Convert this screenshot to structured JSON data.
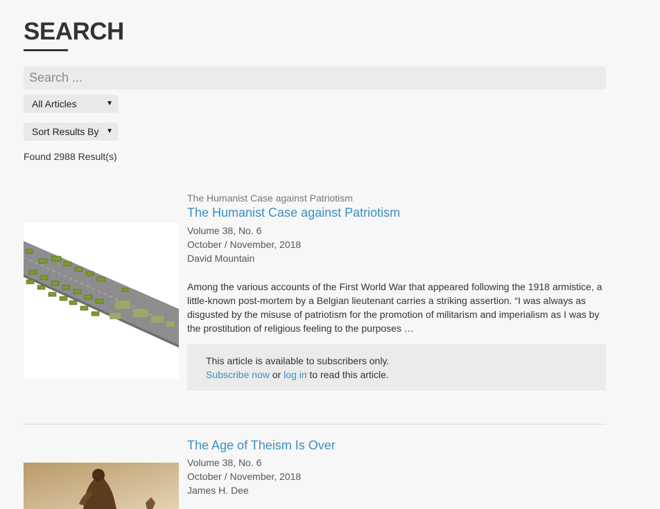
{
  "heading": "SEARCH",
  "search": {
    "placeholder": "Search ..."
  },
  "filters": {
    "category": "All Articles",
    "sort": "Sort Results By"
  },
  "results_count": "Found 2988 Result(s)",
  "results": [
    {
      "kicker": "The Humanist Case against Patriotism",
      "title": "The Humanist Case against Patriotism",
      "volume": "Volume 38, No. 6",
      "date": "October / November, 2018",
      "author": "David Mountain",
      "excerpt": "Among the various accounts of the First World War that appeared following the 1918 armistice, a little-known post-mortem by a Belgian lieutenant carries a striking assertion. “I was always as disgusted by the misuse of patriotism for the promotion of militarism and imperialism as I was by the prostitution of religious feeling to the purposes …",
      "paywall": {
        "notice": "This article is available to subscribers only.",
        "subscribe_link": "Subscribe now",
        "or_text": "or",
        "login_link": "log in",
        "suffix": "to read this article."
      }
    },
    {
      "title": "The Age of Theism Is Over",
      "volume": "Volume 38, No. 6",
      "date": "October / November, 2018",
      "author": "James H. Dee"
    }
  ],
  "colors": {
    "link": "#3a8fc2",
    "background": "#f7f7f7",
    "field": "#ebebeb"
  }
}
